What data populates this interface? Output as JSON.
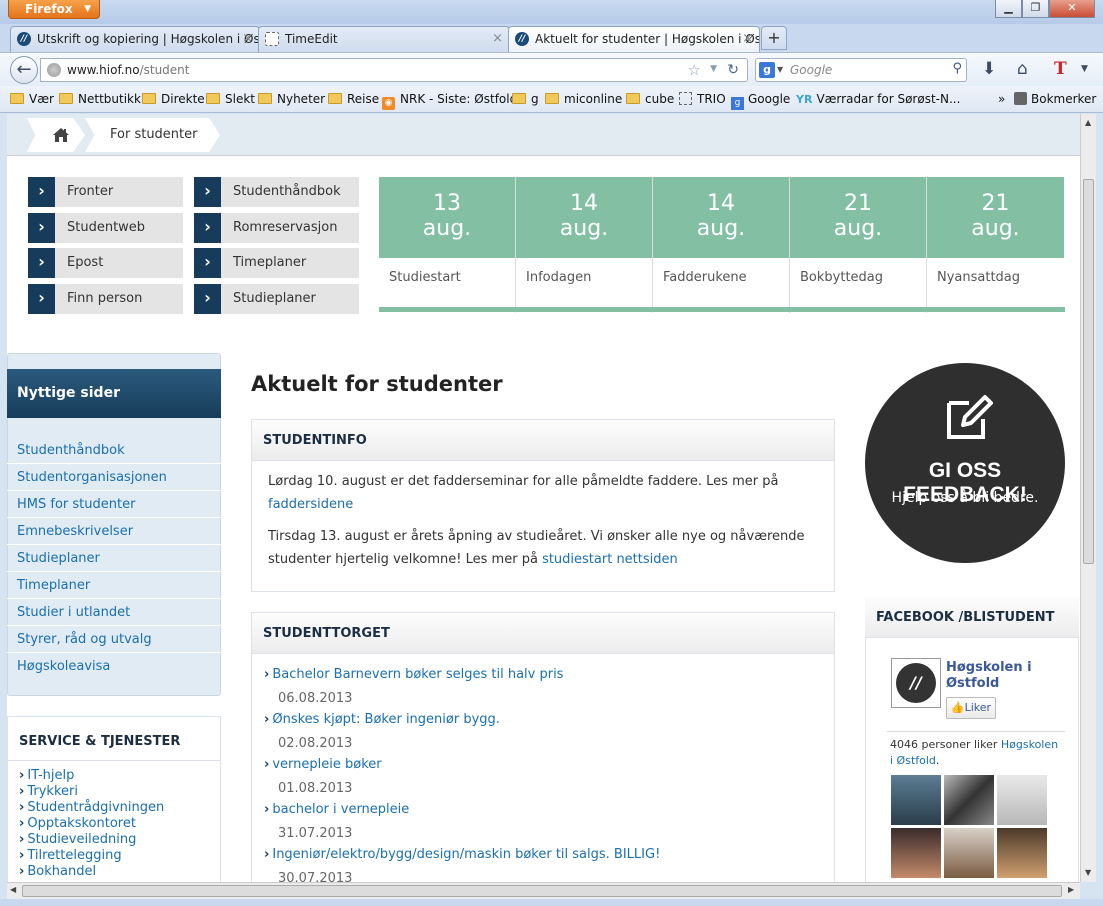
{
  "browser": {
    "app_button": "Firefox",
    "tabs": [
      {
        "title": "Utskrift og kopiering | Høgskolen i Øs..."
      },
      {
        "title": "TimeEdit"
      },
      {
        "title": "Aktuelt for studenter | Høgskolen i Øs..."
      }
    ],
    "new_tab": "+",
    "url_domain": "www.hiof.no",
    "url_path": "/student",
    "search_placeholder": "Google",
    "bookmarks": [
      "Vær",
      "Nettbutikk",
      "Direkte",
      "Slekt",
      "Nyheter",
      "Reise",
      "NRK - Siste: Østfold",
      "g",
      "miconline",
      "cube",
      "TRIO",
      "Google",
      "Værradar for Sørøst-N...",
      "Bokmerker"
    ],
    "overflow": "»"
  },
  "breadcrumb": {
    "current": "For studenter"
  },
  "quick_links": [
    "Fronter",
    "Studentweb",
    "Epost",
    "Finn person",
    "Studenthåndbok",
    "Romreservasjon",
    "Timeplaner",
    "Studieplaner"
  ],
  "events": [
    {
      "day": "13",
      "month": "aug.",
      "label": "Studiestart"
    },
    {
      "day": "14",
      "month": "aug.",
      "label": "Infodagen"
    },
    {
      "day": "14",
      "month": "aug.",
      "label": "Fadderukene"
    },
    {
      "day": "21",
      "month": "aug.",
      "label": "Bokbyttedag"
    },
    {
      "day": "21",
      "month": "aug.",
      "label": "Nyansattdag"
    }
  ],
  "sidebar": {
    "title": "Nyttige sider",
    "links": [
      "Studenthåndbok",
      "Studentorganisasjonen",
      "HMS for studenter",
      "Emnebeskrivelser",
      "Studieplaner",
      "Timeplaner",
      "Studier i utlandet",
      "Styrer, råd og utvalg",
      "Høgskoleavisa"
    ],
    "service_title": "SERVICE & TJENESTER",
    "service_links": [
      "IT-hjelp",
      "Trykkeri",
      "Studentrådgivningen",
      "Opptakskontoret",
      "Studieveiledning",
      "Tilrettelegging",
      "Bokhandel"
    ]
  },
  "main": {
    "title": "Aktuelt for studenter",
    "studentinfo": {
      "heading": "STUDENTINFO",
      "p1_text": "Lørdag 10. august er det fadderseminar for alle påmeldte faddere. Les mer på",
      "p1_link": "faddersidene",
      "p2_text": "Tirsdag 13. august er årets åpning av studieåret. Vi ønsker alle nye og nåværende studenter hjertelig velkomne! Les mer på",
      "p2_link": "studiestart nettsiden"
    },
    "studenttorget": {
      "heading": "STUDENTTORGET",
      "items": [
        {
          "title": "Bachelor Barnevern bøker selges til halv pris",
          "date": "06.08.2013"
        },
        {
          "title": "Ønskes kjøpt: Bøker ingeniør bygg.",
          "date": "02.08.2013"
        },
        {
          "title": "vernepleie bøker",
          "date": "01.08.2013"
        },
        {
          "title": "bachelor i vernepleie",
          "date": "31.07.2013"
        },
        {
          "title": "Ingeniør/elektro/bygg/design/maskin bøker til salgs. BILLIG!",
          "date": "30.07.2013"
        }
      ]
    }
  },
  "feedback": {
    "title": "GI OSS FEEDBACK!",
    "subtitle": "Hjelp oss å bli bedre."
  },
  "facebook": {
    "heading": "FACEBOOK /BLISTUDENT",
    "page_name": "Høgskolen i Østfold",
    "like_button": "Liker",
    "count_text": "4046 personer liker",
    "count_link": "Høgskolen i Østfold",
    "count_end": "."
  },
  "colors": {
    "accent": "#83c0a3",
    "navy": "#173c5b",
    "link": "#1a6fb0",
    "facebook": "#3b5998"
  }
}
